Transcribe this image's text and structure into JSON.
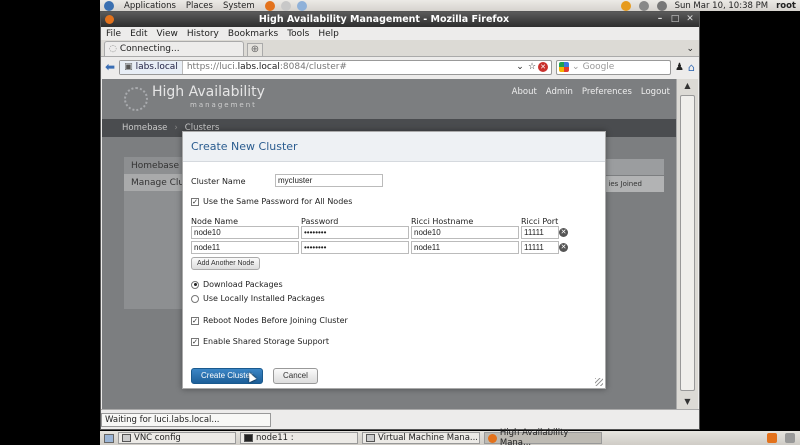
{
  "top_panel": {
    "menus": [
      "Applications",
      "Places",
      "System"
    ],
    "clock": "Sun Mar 10, 10:38 PM",
    "user": "root"
  },
  "window": {
    "title": "High Availability Management - Mozilla Firefox"
  },
  "menu_bar": [
    "File",
    "Edit",
    "View",
    "History",
    "Bookmarks",
    "Tools",
    "Help"
  ],
  "tab": {
    "label": "Connecting..."
  },
  "nav": {
    "site_identity": "labs.local",
    "url_prefix": "https://luci.",
    "url_host": "labs.local",
    "url_suffix": ":8084/cluster#",
    "search_placeholder": "Google"
  },
  "luci": {
    "logo_title": "High Availability",
    "logo_subtitle": "management",
    "header_links": [
      "About",
      "Admin",
      "Preferences",
      "Logout"
    ],
    "nav_items": [
      "Homebase",
      "Clusters"
    ],
    "side_items": [
      "Homebase",
      "Manage Clus"
    ],
    "table_fragment": "ies Joined"
  },
  "modal": {
    "title": "Create New Cluster",
    "cluster_name_label": "Cluster Name",
    "cluster_name_value": "mycluster",
    "same_password_label": "Use the Same Password for All Nodes",
    "columns": [
      "Node Name",
      "Password",
      "Ricci Hostname",
      "Ricci Port"
    ],
    "nodes": [
      {
        "name": "node10",
        "password": "••••••••",
        "hostname": "node10",
        "port": "11111"
      },
      {
        "name": "node11",
        "password": "••••••••",
        "hostname": "node11",
        "port": "11111"
      }
    ],
    "add_node_label": "Add Another Node",
    "download_packages_label": "Download Packages",
    "local_packages_label": "Use Locally Installed Packages",
    "reboot_label": "Reboot Nodes Before Joining Cluster",
    "shared_storage_label": "Enable Shared Storage Support",
    "create_button": "Create Cluster",
    "cancel_button": "Cancel"
  },
  "status": {
    "text": "Waiting for luci.labs.local..."
  },
  "taskbar": {
    "items": [
      "VNC config",
      "node11 :",
      "Virtual Machine Mana...",
      "High Availability Mana..."
    ]
  },
  "colors": {
    "accent": "#2a5c8f",
    "primary_button": "#1d5f99",
    "page_bg": "#7c7e80"
  }
}
